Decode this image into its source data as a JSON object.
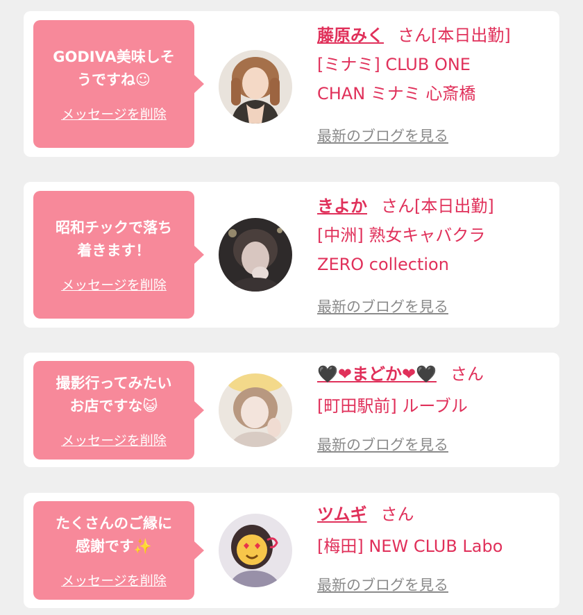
{
  "colors": {
    "accent": "#e0305a",
    "bubble": "#f7899a",
    "background": "#efefef",
    "link_gray": "#8a8a8a"
  },
  "cards": [
    {
      "message": "GODIVA美味しそ\nうですね☺",
      "delete_label": "メッセージを削除",
      "name": "藤原みく",
      "suffix": "さん",
      "shop_line": "[本日出勤]\n[ミナミ] CLUB ONE\nCHAN ミナミ 心斎橋",
      "blog_label": "最新のブログを見る",
      "avatar_icon": "woman-portrait-1"
    },
    {
      "message": "昭和チックで落ち\n着きます！",
      "delete_label": "メッセージを削除",
      "name": "きよか",
      "suffix": "さん",
      "shop_line": "[本日出勤]\n[中洲] 熟女キャバクラ\nZERO collection",
      "blog_label": "最新のブログを見る",
      "avatar_icon": "woman-portrait-2"
    },
    {
      "message": "撮影行ってみたい\nお店ですな😺",
      "delete_label": "メッセージを削除",
      "name": "🖤❤まどか❤🖤",
      "suffix": "さん",
      "shop_line": "[町田駅前] ルーブル",
      "blog_label": "最新のブログを見る",
      "avatar_icon": "woman-portrait-3"
    },
    {
      "message": "たくさんのご縁に\n感謝です✨",
      "delete_label": "メッセージを削除",
      "name": "ツムギ",
      "suffix": "さん",
      "shop_line": "[梅田] NEW CLUB Labo",
      "blog_label": "最新のブログを見る",
      "avatar_icon": "woman-portrait-4"
    }
  ]
}
